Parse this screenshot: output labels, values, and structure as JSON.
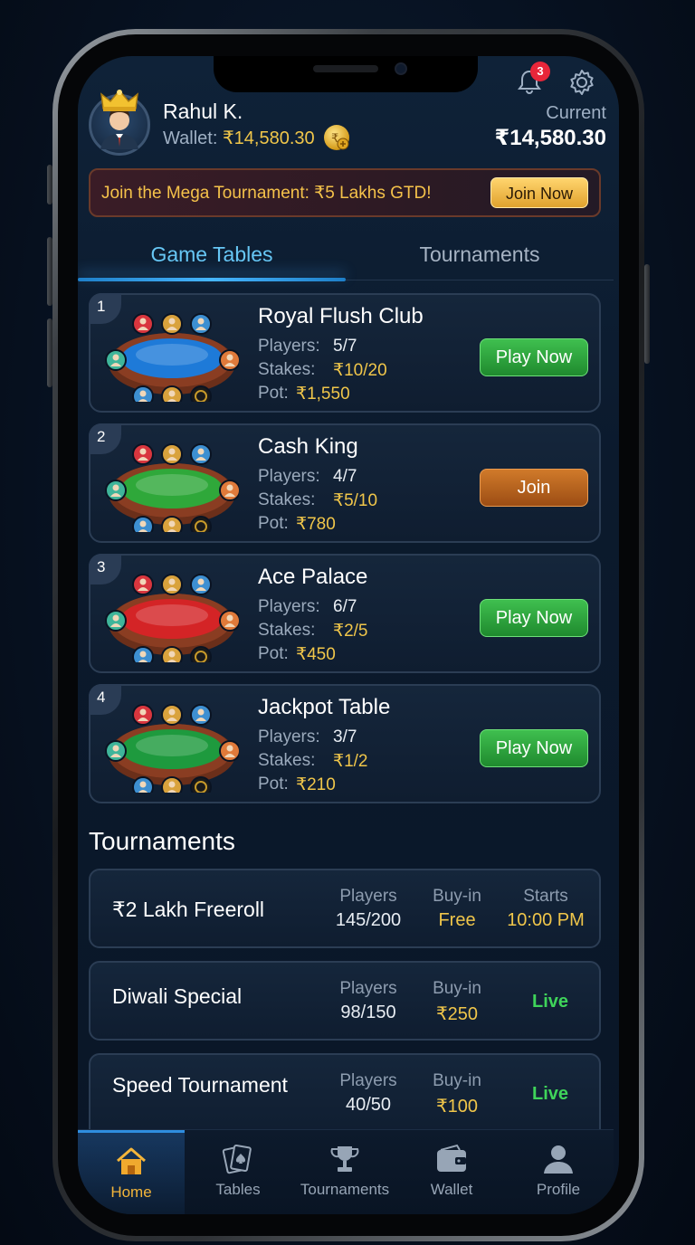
{
  "header": {
    "notification_count": "3",
    "user_name": "Rahul K.",
    "wallet_label": "Wallet: ",
    "wallet_amount": "₹14,580.30",
    "current_label": "Current",
    "current_value": "₹14,580.30"
  },
  "promo": {
    "text": "Join the Mega Tournament: ₹5 Lakhs GTD!",
    "button": "Join Now"
  },
  "tabs": [
    {
      "label": "Game Tables",
      "active": true
    },
    {
      "label": "Tournaments",
      "active": false
    }
  ],
  "tables": [
    {
      "rank": "1",
      "name": "Royal Flush Club",
      "players_label": "Players:",
      "players": "5/7",
      "stakes_label": "Stakes:",
      "stakes": "₹10/20",
      "pot_label": "Pot:",
      "pot": "₹1,550",
      "button": "Play Now",
      "felt_color": "#1e7ad8"
    },
    {
      "rank": "2",
      "name": "Cash King",
      "players_label": "Players:",
      "players": "4/7",
      "stakes_label": "Stakes:",
      "stakes": "₹5/10",
      "pot_label": "Pot:",
      "pot": "₹780",
      "button": "Join",
      "felt_color": "#2fa83a"
    },
    {
      "rank": "3",
      "name": "Ace Palace",
      "players_label": "Players:",
      "players": "6/7",
      "stakes_label": "Stakes:",
      "stakes": "₹2/5",
      "pot_label": "Pot:",
      "pot": "₹450",
      "button": "Play Now",
      "felt_color": "#d42426"
    },
    {
      "rank": "4",
      "name": "Jackpot Table",
      "players_label": "Players:",
      "players": "3/7",
      "stakes_label": "Stakes:",
      "stakes": "₹1/2",
      "pot_label": "Pot:",
      "pot": "₹210",
      "button": "Play Now",
      "felt_color": "#1e9a3e"
    }
  ],
  "tournaments_section": {
    "title": "Tournaments",
    "items": [
      {
        "name": "₹2 Lakh Freeroll",
        "players_label": "Players",
        "players": "145/200",
        "buyin_label": "Buy-in",
        "buyin": "Free",
        "starts_label": "Starts",
        "starts": "10:00 PM",
        "status": ""
      },
      {
        "name": "Diwali Special",
        "players_label": "Players",
        "players": "98/150",
        "buyin_label": "Buy-in",
        "buyin": "₹250",
        "starts_label": "",
        "starts": "",
        "status": "Live"
      },
      {
        "name": "Speed Tournament",
        "players_label": "Players",
        "players": "40/50",
        "buyin_label": "Buy-in",
        "buyin": "₹100",
        "starts_label": "",
        "starts": "",
        "status": "Live"
      }
    ]
  },
  "nav": [
    {
      "label": "Home",
      "icon": "home-icon",
      "active": true
    },
    {
      "label": "Tables",
      "icon": "cards-icon",
      "active": false
    },
    {
      "label": "Tournaments",
      "icon": "trophy-icon",
      "active": false
    },
    {
      "label": "Wallet",
      "icon": "wallet-icon",
      "active": false
    },
    {
      "label": "Profile",
      "icon": "profile-icon",
      "active": false
    }
  ],
  "colors": {
    "accent_blue": "#46b6ff",
    "gold": "#f0c64a",
    "green_button": "#3fbf4f",
    "orange_button": "#d07a2a",
    "live_green": "#3fd45a",
    "notification_red": "#e8263a"
  }
}
